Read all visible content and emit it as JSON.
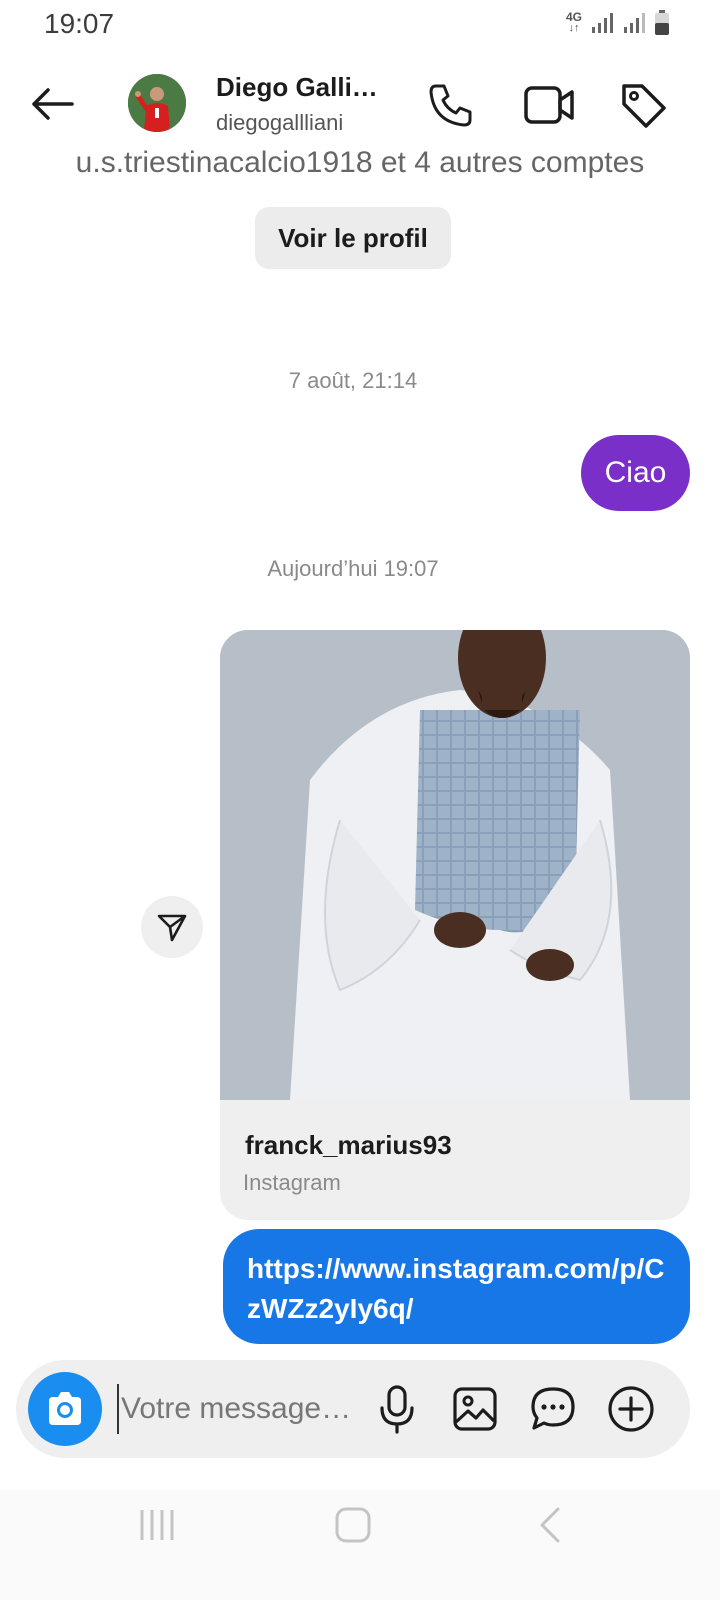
{
  "status_bar": {
    "time": "19:07",
    "network": "4G",
    "icons": [
      "network-4g-icon",
      "signal-icon",
      "signal-icon",
      "battery-icon"
    ]
  },
  "header": {
    "contact_name": "Diego Galli…",
    "contact_handle": "diegogallliani",
    "icons": [
      "back-arrow-icon",
      "phone-icon",
      "video-camera-icon",
      "tag-icon"
    ]
  },
  "profile": {
    "followers_text": "u.s.triestinacalcio1918 et 4 autres comptes",
    "view_profile_label": "Voir le profil"
  },
  "messages": {
    "date_1": "7 août, 21:14",
    "ciao_text": "Ciao",
    "date_2": "Aujourd’hui 19:07",
    "shared_post": {
      "author": "franck_marius93",
      "source": "Instagram"
    },
    "link_text": "https://www.instagram.com/p/CzWZz2yIy6q/"
  },
  "composer": {
    "placeholder": "Votre message…",
    "icons": [
      "camera-icon",
      "microphone-icon",
      "image-gallery-icon",
      "sticker-chat-icon",
      "plus-circle-icon"
    ]
  },
  "colors": {
    "outgoing_purple": "#7b2fc9",
    "outgoing_blue": "#1877e6",
    "camera_button": "#1a8ef0",
    "bubble_grey": "#efefef"
  }
}
